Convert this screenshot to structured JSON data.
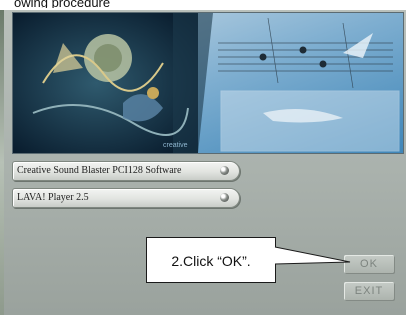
{
  "caption": "owing procedure",
  "software_list": [
    {
      "label": "Creative Sound Blaster PCI128 Software",
      "icon": "cd-icon"
    },
    {
      "label": "LAVA! Player 2.5",
      "icon": "cd-icon"
    }
  ],
  "callout": {
    "text": "2.Click “OK”."
  },
  "buttons": {
    "ok": "OK",
    "exit": "EXIT"
  },
  "banner": {
    "watermark": "creative"
  },
  "colors": {
    "window_bg": "#a9b1ac",
    "banner_sky": "#6f9fc5",
    "banner_dark": "#0f2a3a"
  }
}
